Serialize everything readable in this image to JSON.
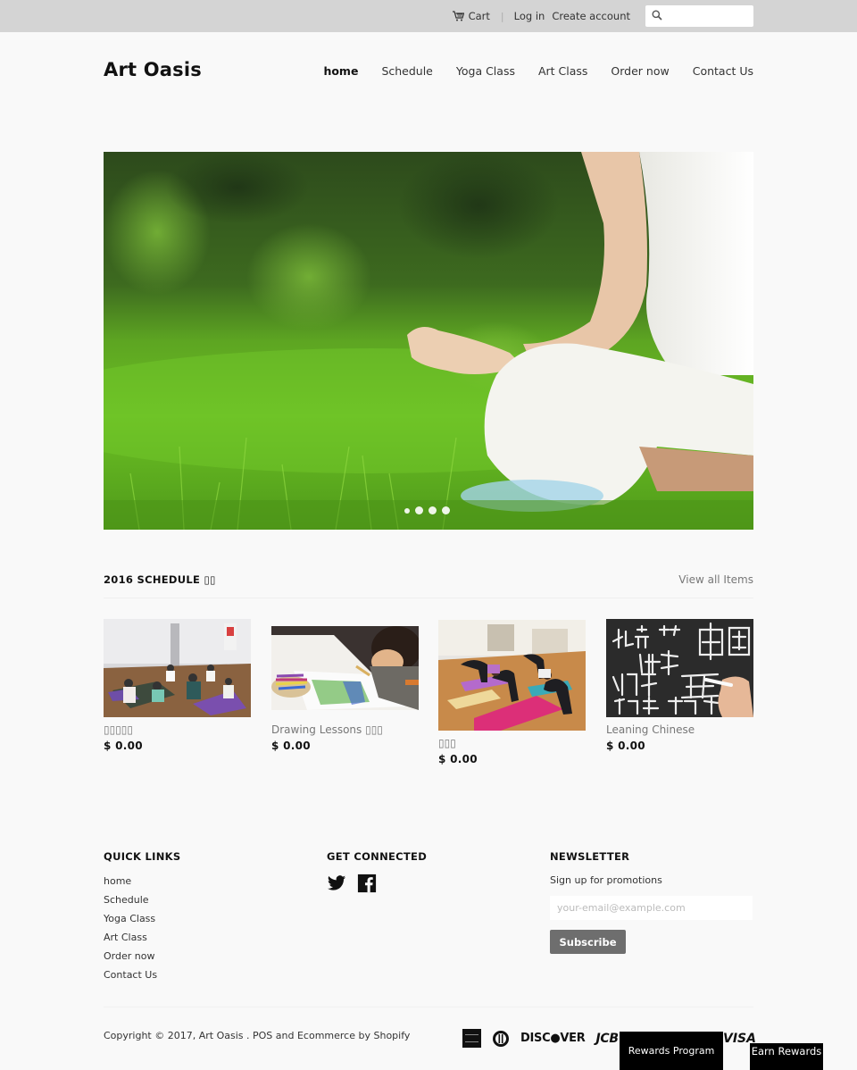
{
  "topbar": {
    "cart_label": "Cart",
    "separator": "|",
    "login_label": "Log in",
    "create_account_label": "Create account",
    "search_placeholder": ""
  },
  "header": {
    "logo": "Art Oasis",
    "nav": [
      {
        "label": "home",
        "active": true
      },
      {
        "label": "Schedule",
        "active": false
      },
      {
        "label": "Yoga Class",
        "active": false
      },
      {
        "label": "Art Class",
        "active": false
      },
      {
        "label": "Order now",
        "active": false
      },
      {
        "label": "Contact Us",
        "active": false
      }
    ]
  },
  "slideshow": {
    "slide_count": 4,
    "active_slide": 1
  },
  "schedule": {
    "title": "2016 SCHEDULE ▯▯",
    "view_all_label": "View all Items",
    "products": [
      {
        "name": "▯▯▯▯▯",
        "price": "$ 0.00"
      },
      {
        "name": "Drawing Lessons ▯▯▯",
        "price": "$ 0.00"
      },
      {
        "name": "▯▯▯",
        "price": "$ 0.00"
      },
      {
        "name": "Leaning Chinese",
        "price": "$ 0.00"
      }
    ]
  },
  "footer": {
    "quick_links_title": "QUICK LINKS",
    "quick_links": [
      "home",
      "Schedule",
      "Yoga Class",
      "Art Class",
      "Order now",
      "Contact Us"
    ],
    "get_connected_title": "GET CONNECTED",
    "newsletter_title": "NEWSLETTER",
    "newsletter_text": "Sign up for promotions",
    "email_placeholder": "your-email@example.com",
    "subscribe_label": "Subscribe",
    "copyright_prefix": "Copyright © 2017, ",
    "copyright_store": "Art Oasis",
    "copyright_sep": " . ",
    "copyright_powered": "POS and Ecommerce by Shopify",
    "payments": {
      "discover": "DISC●VER",
      "jcb": "JCB",
      "visa": "VISA"
    },
    "rewards_program_label": "Rewards Program",
    "earn_rewards_label": "Earn Rewards"
  }
}
